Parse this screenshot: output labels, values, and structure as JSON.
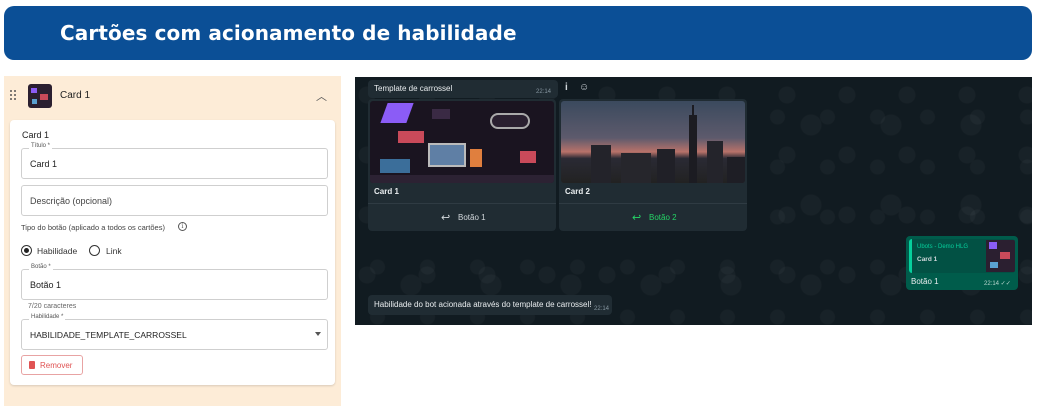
{
  "banner": {
    "title": "Cartões com acionamento de habilidade"
  },
  "editor": {
    "card_name": "Card 1",
    "form_heading": "Card 1",
    "title_field": {
      "label": "Título *",
      "value": "Card 1"
    },
    "description_field": {
      "placeholder": "Descrição (opcional)"
    },
    "button_type_label": "Tipo do botão (aplicado a todos os cartões)",
    "radio_options": [
      "Habilidade",
      "Link"
    ],
    "radio_selected": "Habilidade",
    "button_field": {
      "label": "Botão *",
      "value": "Botão 1",
      "helper": "7/20 caracteres"
    },
    "skill_field": {
      "label": "Habilidade *",
      "value": "HABILIDADE_TEMPLATE_CARROSSEL"
    },
    "remove_label": "Remover"
  },
  "chat": {
    "template_message": {
      "text": "Template de carrossel",
      "time": "22:14"
    },
    "header_icons": [
      "info-icon",
      "emoji-icon"
    ],
    "cards": [
      {
        "title": "Card 1",
        "button_label": "Botão 1",
        "button_color": "#d1d7db"
      },
      {
        "title": "Card 2",
        "button_label": "Botão 2",
        "button_color": "#25d366"
      }
    ],
    "sent_message": {
      "quote_name": "Ubots - Demo HLG",
      "quote_text": "Card 1",
      "text": "Botão 1",
      "time": "22:14 ✓✓"
    },
    "bot_message": {
      "text": "Habilidade do bot acionada através do template de carrossel!",
      "time": "22:14"
    }
  },
  "colors": {
    "banner": "#0b4f96",
    "panel": "#fdecd7",
    "chat_bg": "#111b21",
    "sent_bubble": "#005c4b",
    "accent_green": "#25d366",
    "danger": "#e05353"
  }
}
